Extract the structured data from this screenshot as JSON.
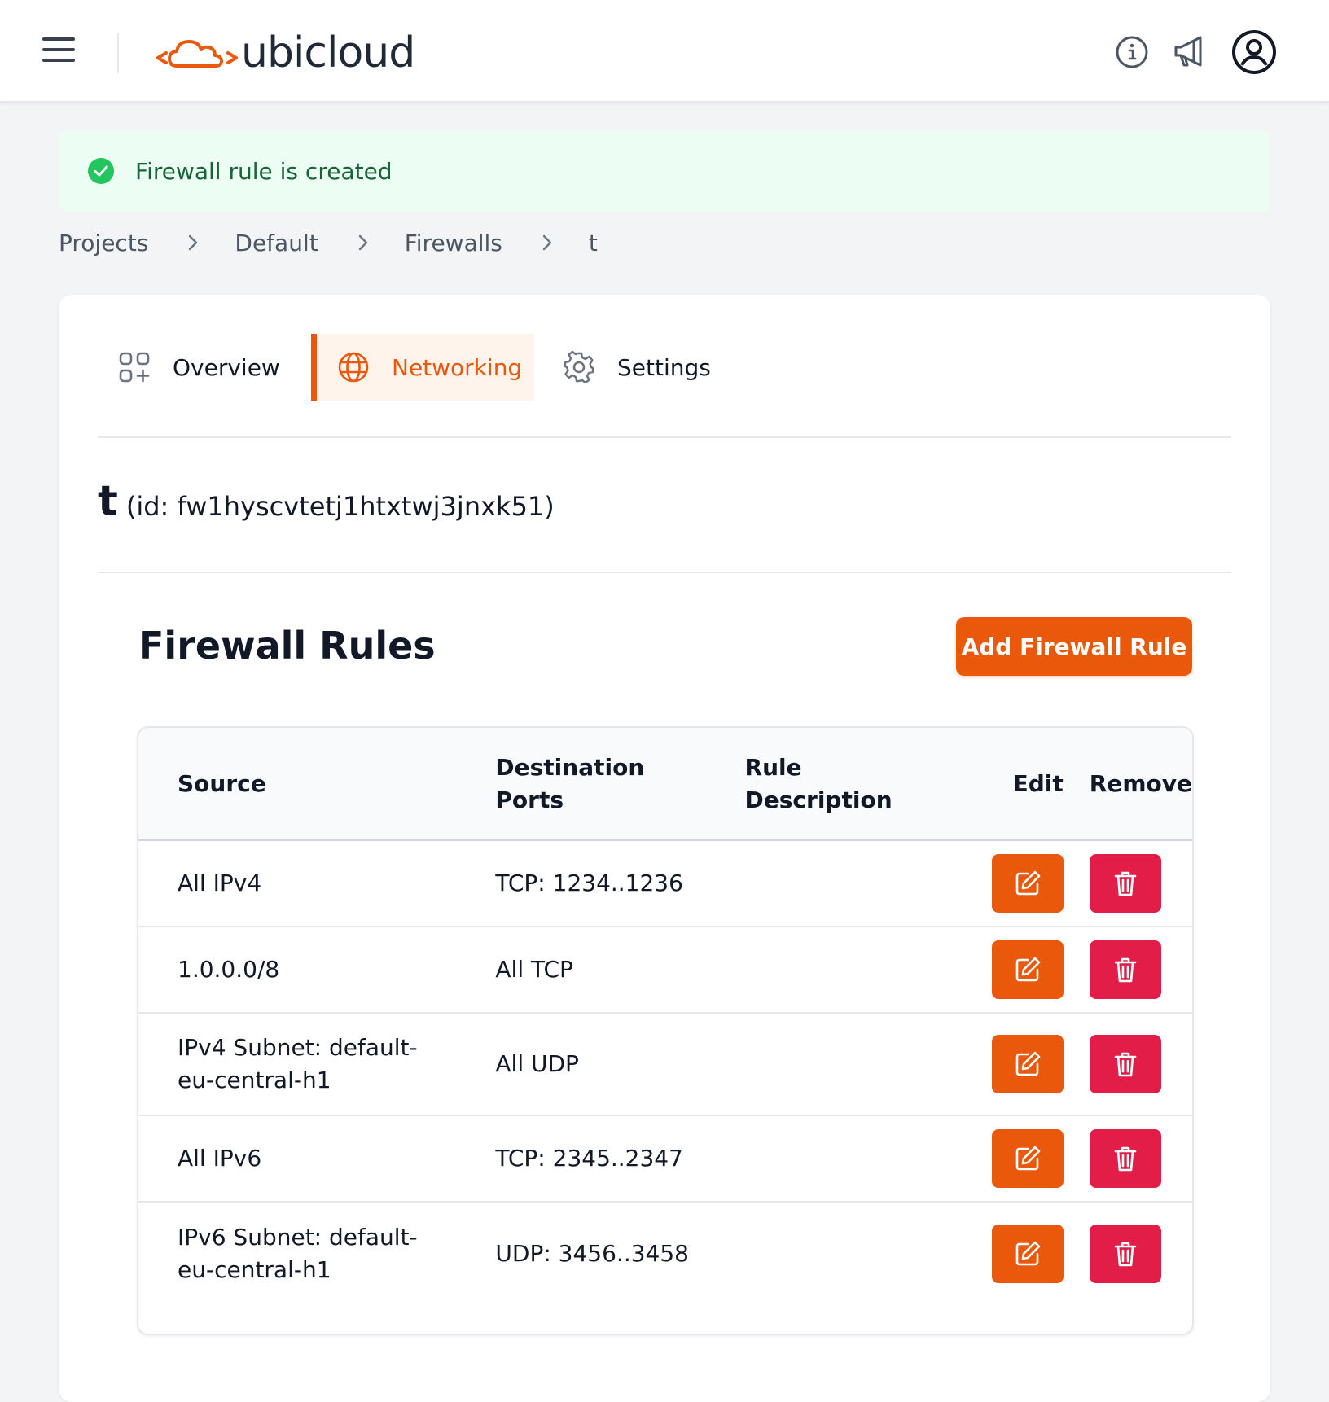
{
  "header": {
    "brand": "ubicloud",
    "icons": [
      "menu-icon",
      "info-icon",
      "megaphone-icon",
      "user-icon"
    ]
  },
  "flash": {
    "message": "Firewall rule is created"
  },
  "breadcrumb": [
    "Projects",
    "Default",
    "Firewalls",
    "t"
  ],
  "tabs": [
    {
      "label": "Overview",
      "icon": "overview-icon"
    },
    {
      "label": "Networking",
      "icon": "globe-icon",
      "active": true
    },
    {
      "label": "Settings",
      "icon": "gear-icon"
    }
  ],
  "firewall": {
    "name": "t",
    "id_text": "(id: fw1hyscvtetj1htxtwj3jnxk51)"
  },
  "rules": {
    "heading": "Firewall Rules",
    "add_label": "Add Firewall Rule",
    "columns": {
      "source": "Source",
      "ports": "Destination Ports",
      "description": "Rule Description",
      "edit": "Edit",
      "remove": "Remove"
    },
    "rows": [
      {
        "source": "All IPv4",
        "ports": "TCP: 1234..1236",
        "description": ""
      },
      {
        "source": "1.0.0.0/8",
        "ports": "All TCP",
        "description": ""
      },
      {
        "source": "IPv4 Subnet: default-eu-central-h1",
        "ports": "All UDP",
        "description": ""
      },
      {
        "source": "All IPv6",
        "ports": "TCP: 2345..2347",
        "description": ""
      },
      {
        "source": "IPv6 Subnet: default-eu-central-h1",
        "ports": "UDP: 3456..3458",
        "description": ""
      }
    ]
  },
  "colors": {
    "accent": "#ea580c",
    "danger": "#e11d48",
    "success": "#22c55e"
  }
}
